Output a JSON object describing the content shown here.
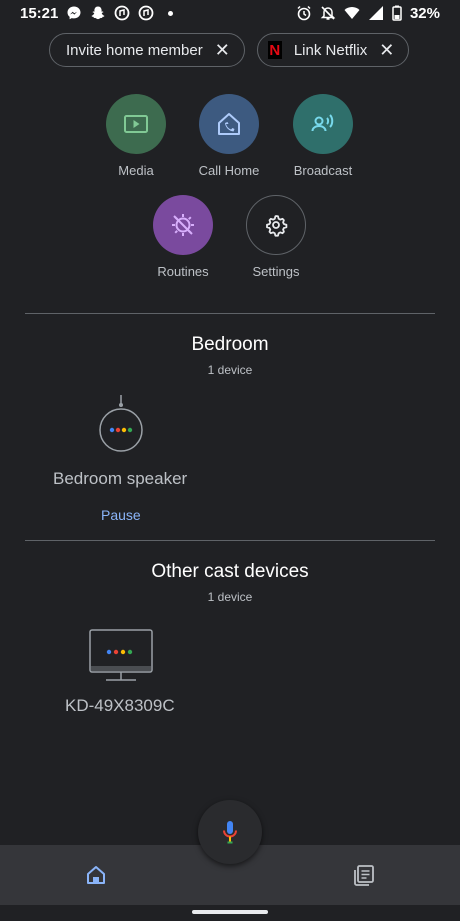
{
  "status_bar": {
    "time": "15:21",
    "battery": "32%",
    "left_icons": [
      "messenger-icon",
      "snapchat-icon",
      "music-icon",
      "music-icon",
      "dot-icon"
    ],
    "right_icons": [
      "alarm-icon",
      "mute-icon",
      "wifi-icon",
      "signal-icon",
      "battery-icon"
    ]
  },
  "chips": [
    {
      "label": "Invite home member"
    },
    {
      "label": "Link Netflix"
    }
  ],
  "actions": [
    {
      "label": "Media",
      "color": "#3d6b4f",
      "icon": "play-icon"
    },
    {
      "label": "Call Home",
      "color": "#3d5a80",
      "icon": "phone-house-icon"
    },
    {
      "label": "Broadcast",
      "color": "#2f6f6b",
      "icon": "broadcast-icon"
    },
    {
      "label": "Routines",
      "color": "#7a4a9e",
      "icon": "routines-icon"
    },
    {
      "label": "Settings",
      "color": "#202124",
      "icon": "gear-icon"
    }
  ],
  "rooms": [
    {
      "title": "Bedroom",
      "count": "1 device",
      "devices": [
        {
          "name": "Bedroom speaker",
          "action": "Pause"
        }
      ]
    },
    {
      "title": "Other cast devices",
      "count": "1 device",
      "devices": [
        {
          "name": "KD-49X8309C"
        }
      ]
    }
  ],
  "colors": {
    "background": "#202124",
    "accent": "#8ab4f8",
    "google_blue": "#4285f4",
    "google_red": "#ea4335",
    "google_yellow": "#fbbc05",
    "google_green": "#34a853"
  },
  "nav": {
    "items": [
      {
        "icon": "home-icon",
        "active": true
      },
      {
        "icon": "feed-icon",
        "active": false
      }
    ],
    "fab_icon": "mic-icon"
  }
}
